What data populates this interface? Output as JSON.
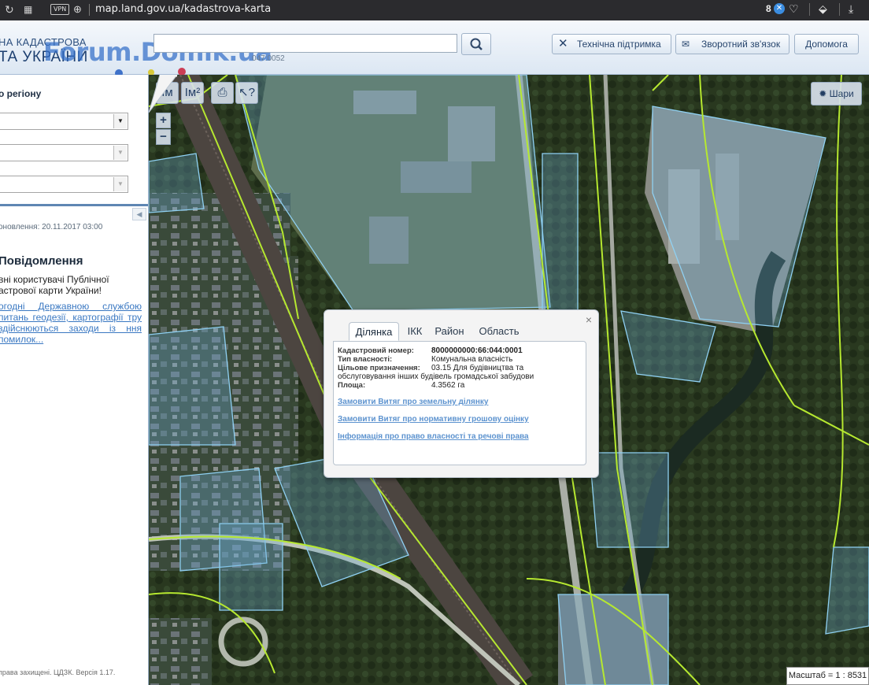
{
  "browser": {
    "url": "map.land.gov.ua/kadastrova-karta",
    "vpn_label": "VPN",
    "tab_count": "8",
    "icons": [
      "reload-icon",
      "grid-icon",
      "globe-icon",
      "heart-icon",
      "extension-icon",
      "download-icon"
    ]
  },
  "header": {
    "title_line1": "НА КАДАСТРОВА",
    "title_line2": "ТА УКРАЇНИ",
    "watermark": "Forum.Domik.ua",
    "search_value": "",
    "search_hint": "047:0052",
    "buttons": {
      "support": "Технічна підтримка",
      "feedback": "Зворотний зв'язок",
      "help": "Допомога"
    }
  },
  "sidebar": {
    "region_title": "о регіону",
    "updated": "оновлення: 20.11.2017 03:00",
    "message_title": "Повідомлення",
    "message_text": "вні користувачі Публічної астрової карти України!",
    "message_link": "огодні Державною службою питань геодезії, картографії тру здійснюються заходи із ння помилок...",
    "footer": "права захищені. ЦДЗК. Версія 1.17."
  },
  "map": {
    "tools": [
      "Iм",
      "Iм²"
    ],
    "layers_label": "Шари",
    "scale": "Масштаб = 1 : 8531",
    "zoom_in": "+",
    "zoom_out": "−"
  },
  "popup": {
    "close": "×",
    "tabs": [
      "Ділянка",
      "ІКК",
      "Район",
      "Область"
    ],
    "active_tab": "Ділянка",
    "rows": [
      {
        "label": "Кадастровий номер:",
        "value": "8000000000:66:044:0001"
      },
      {
        "label": "Тип власності:",
        "value": "Комунальна власність"
      },
      {
        "label": "Цільове призначення:",
        "value": "03.15 Для будівництва та обслуговування інших будівель громадської забудови"
      },
      {
        "label": "Площа:",
        "value": "4.3562 га"
      }
    ],
    "links": [
      "Замовити Витяг про земельну ділянку",
      "Замовити Витяг про нормативну грошову оцінку",
      "Інформація про право власності та речові права"
    ]
  }
}
